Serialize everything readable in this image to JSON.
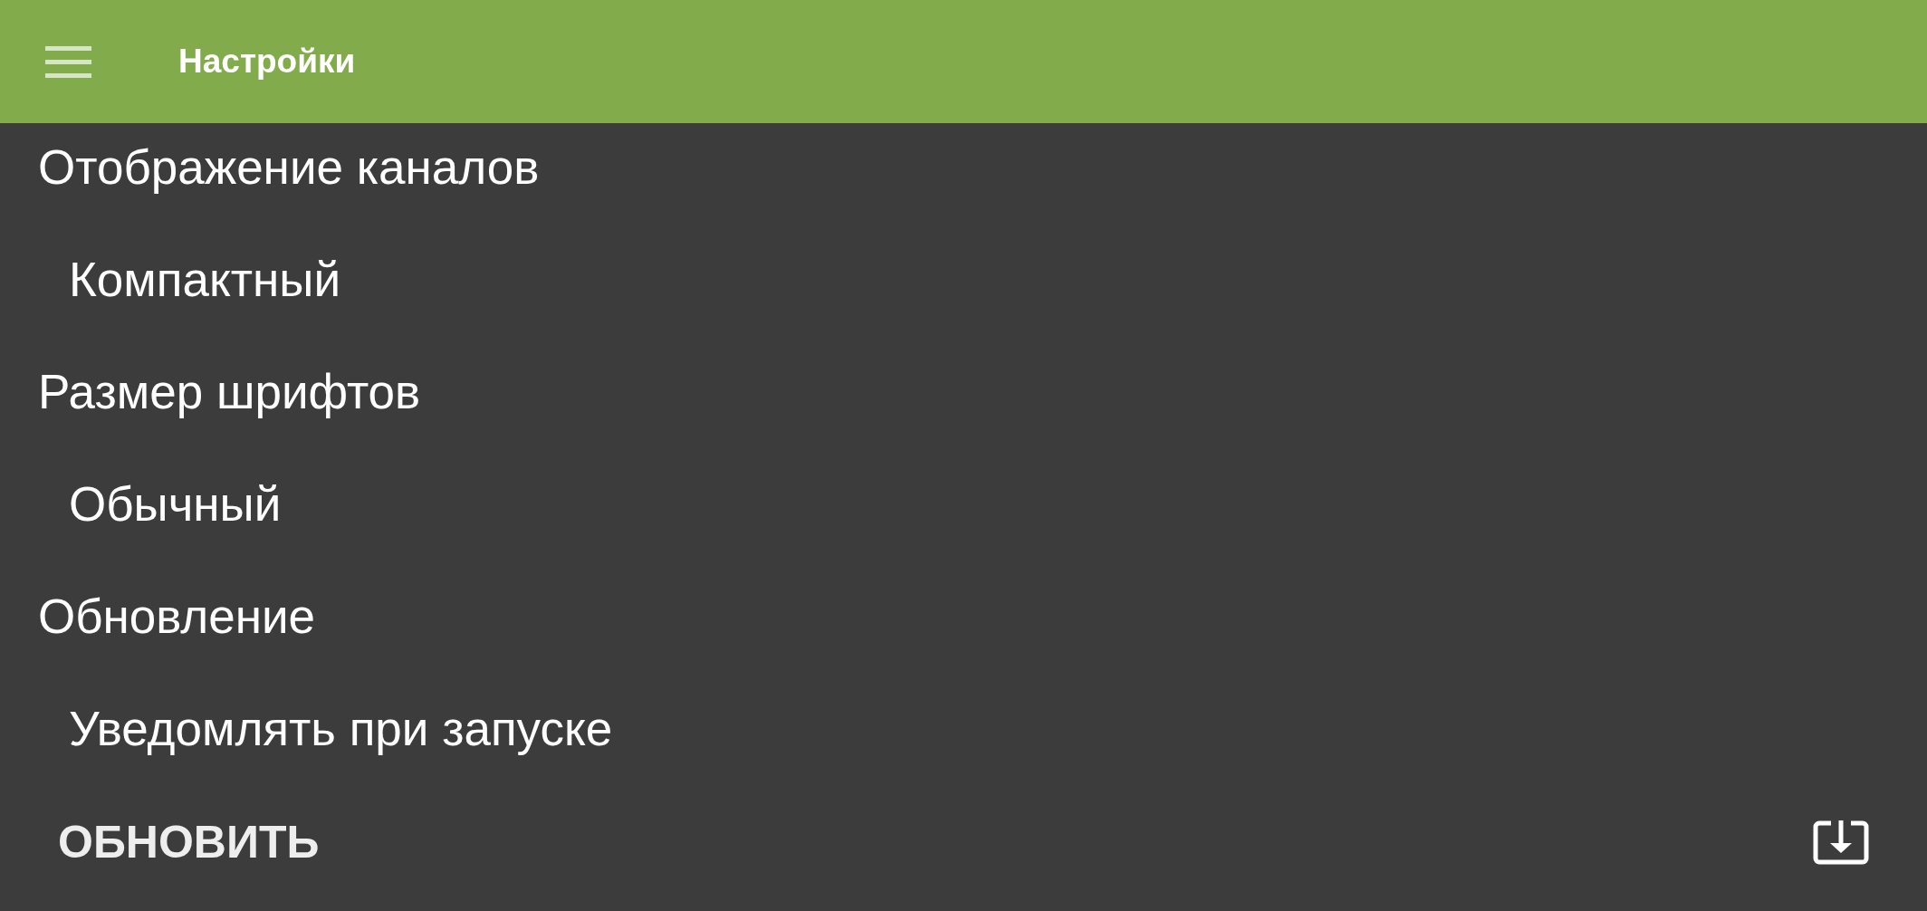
{
  "app_bar": {
    "title": "Настройки"
  },
  "settings": [
    {
      "title": "Отображение каналов",
      "value": "Компактный"
    },
    {
      "title": "Размер шрифтов",
      "value": "Обычный"
    },
    {
      "title": "Обновление",
      "value": "Уведомлять при запуске"
    }
  ],
  "footer": {
    "button": "ОБНОВИТЬ"
  }
}
